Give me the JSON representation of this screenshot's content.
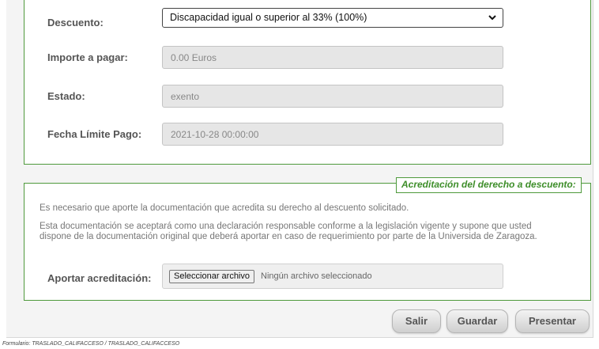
{
  "form": {
    "descuento_label": "Descuento:",
    "descuento_selected": "Discapacidad igual o superior al 33% (100%)",
    "importe_label": "Importe a pagar:",
    "importe_value": "0.00 Euros",
    "estado_label": "Estado:",
    "estado_value": "exento",
    "fecha_label": "Fecha Límite Pago:",
    "fecha_value": "2021-10-28 00:00:00"
  },
  "acreditacion": {
    "legend": "Acreditación del derecho a descuento:",
    "paragraph1": "Es necesario que aporte la documentación que acredita su derecho al descuento solicitado.",
    "paragraph2_line1": "Esta documentación se aceptará como una declaración responsable conforme a la legislación vigente y supone que usted",
    "paragraph2_line2": "dispone de la documentación original que deberá aportar en caso de requerimiento por parte de la Universida de Zaragoza.",
    "aportar_label": "Aportar acreditación:",
    "file_button": "Seleccionar archivo",
    "file_status": "Ningún archivo seleccionado"
  },
  "actions": {
    "salir": "Salir",
    "guardar": "Guardar",
    "presentar": "Presentar"
  },
  "footer": {
    "text": "Formulario: TRASLADO_CALIFACCESO / TRASLADO_CALIFACCESO"
  },
  "colors": {
    "border_green": "#4f9a3c",
    "legend_green": "#3e8e2a"
  }
}
